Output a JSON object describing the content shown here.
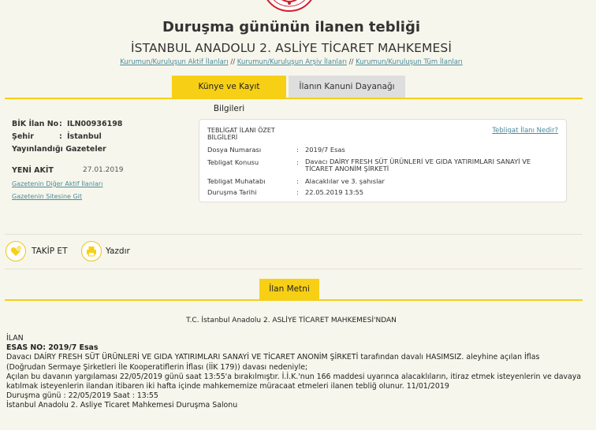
{
  "header": {
    "title": "Duruşma gününün ilanen tebliği",
    "court": "İSTANBUL ANADOLU 2. ASLİYE TİCARET MAHKEMESİ",
    "links": [
      "Kurumun/Kuruluşun Aktif İlanları",
      "Kurumun/Kuruluşun Arşiv İlanları",
      "Kurumun/Kuruluşun Tüm İlanları"
    ],
    "link_separator": "//"
  },
  "tabs": {
    "kunye": "Künye ve Kayıt Bilgileri",
    "dayanak": "İlanın Kanuni Dayanağı"
  },
  "left": {
    "bik_label": "BİK İlan No",
    "bik_colon": ":",
    "bik_value": "ILN00936198",
    "sehir_label": "Şehir",
    "sehir_colon": ":",
    "sehir_value": "İstanbul",
    "gazete_label": "Yayınlandığı Gazeteler",
    "gazete_name": "YENİ AKİT",
    "gazete_date": "27.01.2019",
    "other_ads_link": "Gazetenin Diğer Aktif İlanları",
    "site_link": "Gazetenin Sitesine Git"
  },
  "summary": {
    "title": "TEBLİGAT İLANI ÖZET BİLGİLERİ",
    "help_link": "Tebligat İlanı Nedir?",
    "rows": [
      {
        "label": "Dosya Numarası",
        "value": "2019/7 Esas"
      },
      {
        "label": "Tebligat Konusu",
        "value": "Davacı DAİRY FRESH SÜT ÜRÜNLERİ VE GIDA YATIRIMLARI SANAYİ VE TİCARET ANONİM ŞİRKETİ"
      },
      {
        "label": "Tebligat Muhatabı",
        "value": "Alacaklılar ve 3. şahıslar"
      },
      {
        "label": "Duruşma Tarihi",
        "value": "22.05.2019 13:55"
      }
    ]
  },
  "actions": {
    "follow": "TAKİP ET",
    "print": "Yazdır"
  },
  "ilan_tab": "İlan Metni",
  "document": {
    "heading": "T.C. İstanbul Anadolu 2. ASLİYE TİCARET MAHKEMESİ'NDAN",
    "lines": [
      "İLAN",
      "ESAS NO: 2019/7 Esas",
      "Davacı DAİRY FRESH SÜT ÜRÜNLERİ VE GIDA YATIRIMLARI SANAYİ VE TİCARET ANONİM ŞİRKETİ tarafından davalı HASIMSIZ. aleyhine açılan İflas",
      "(Doğrudan Sermaye Şirketleri İle Kooperatiflerin İflası (İİK 179)) davası nedeniyle;",
      "Açılan bu davanın yargılaması 22/05/2019 günü saat 13:55'a bırakılmıştır. İ.İ.K.'nun 166 maddesi uyarınca alacaklıların, itiraz etmek isteyenlerin ve davaya",
      "katılmak isteyenlerin ilandan itibaren iki hafta içinde mahkememize müracaat etmeleri ilanen tebliğ olunur. 11/01/2019",
      "Duruşma günü : 22/05/2019 Saat : 13:55",
      "İstanbul Anadolu 2. Asliye Ticaret Mahkemesi Duruşma Salonu"
    ]
  },
  "colors": {
    "accent": "#f7d016",
    "link": "#4a8a9a",
    "background": "#f7f6ec"
  }
}
